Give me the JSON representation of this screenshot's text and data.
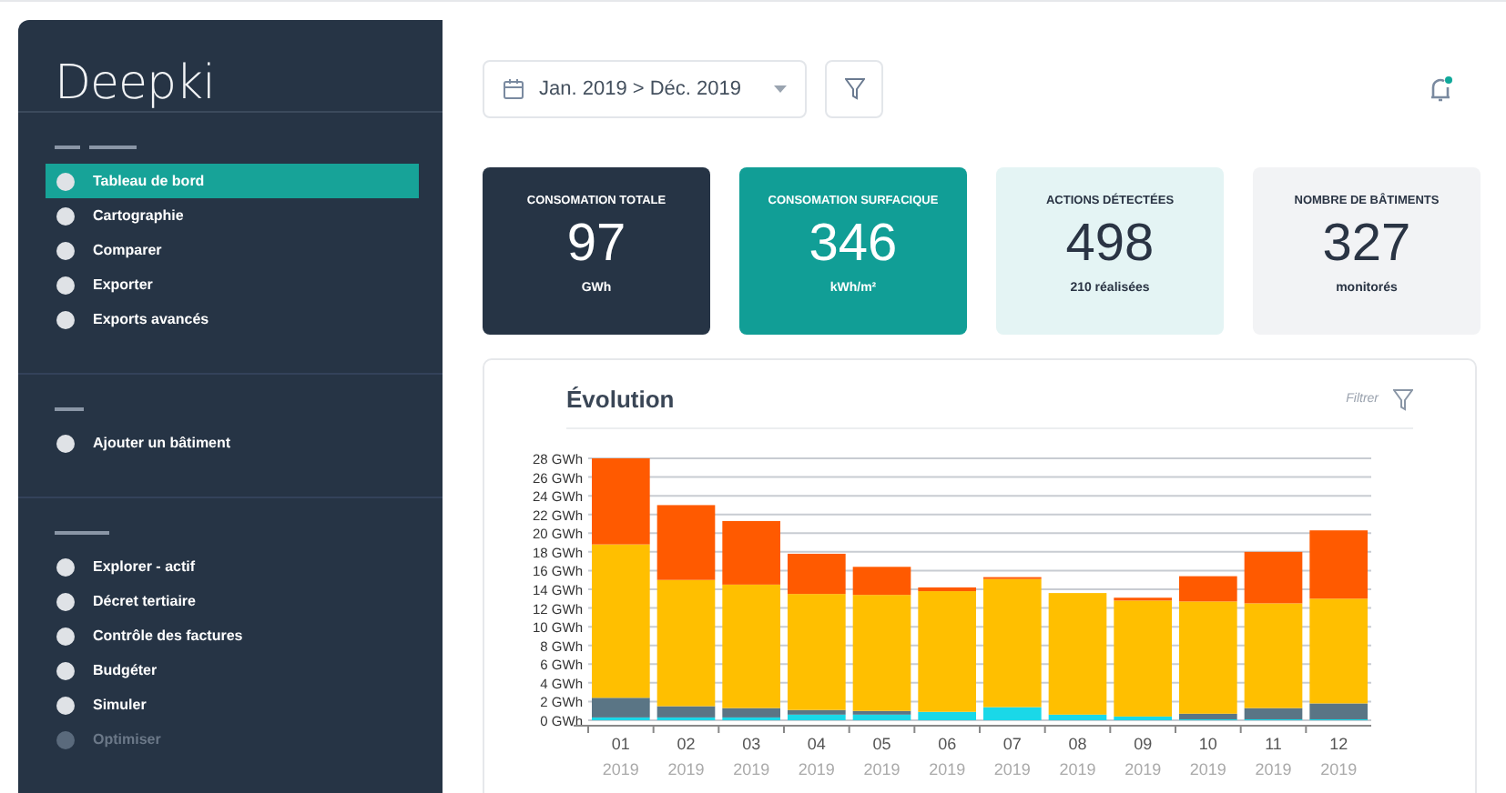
{
  "sidebar": {
    "logo": "Deepki",
    "sections": [
      {
        "items": [
          {
            "label": "Tableau de bord",
            "selected": true,
            "disabled": false
          },
          {
            "label": "Cartographie",
            "selected": false,
            "disabled": false
          },
          {
            "label": "Comparer",
            "selected": false,
            "disabled": false
          },
          {
            "label": "Exporter",
            "selected": false,
            "disabled": false
          },
          {
            "label": "Exports avancés",
            "selected": false,
            "disabled": false
          }
        ]
      },
      {
        "items": [
          {
            "label": "Ajouter un bâtiment",
            "selected": false,
            "disabled": false
          }
        ]
      },
      {
        "items": [
          {
            "label": "Explorer - actif",
            "selected": false,
            "disabled": false
          },
          {
            "label": "Décret tertiaire",
            "selected": false,
            "disabled": false
          },
          {
            "label": "Contrôle des factures",
            "selected": false,
            "disabled": false
          },
          {
            "label": "Budgéter",
            "selected": false,
            "disabled": false
          },
          {
            "label": "Simuler",
            "selected": false,
            "disabled": false
          },
          {
            "label": "Optimiser",
            "selected": false,
            "disabled": true
          }
        ]
      }
    ]
  },
  "toolbar": {
    "date_range": "Jan. 2019 > Déc. 2019",
    "notification_dot": true
  },
  "kpis": [
    {
      "kind": "dark",
      "title": "CONSOMATION TOTALE",
      "value": "97",
      "caption": "GWh"
    },
    {
      "kind": "teal",
      "title": "CONSOMATION SURFACIQUE",
      "value": "346",
      "caption": "kWh/m²"
    },
    {
      "kind": "pale",
      "title": "ACTIONS DÉTECTÉES",
      "value": "498",
      "caption": "210 réalisées"
    },
    {
      "kind": "grey",
      "title": "NOMBRE DE BÂTIMENTS",
      "value": "327",
      "caption": "monitorés"
    }
  ],
  "evolution": {
    "title": "Évolution",
    "filter_label": "Filtrer",
    "chart_data": {
      "type": "bar",
      "stacked": true,
      "grid": true,
      "categories": [
        {
          "month": "01",
          "year": "2019"
        },
        {
          "month": "02",
          "year": "2019"
        },
        {
          "month": "03",
          "year": "2019"
        },
        {
          "month": "04",
          "year": "2019"
        },
        {
          "month": "05",
          "year": "2019"
        },
        {
          "month": "06",
          "year": "2019"
        },
        {
          "month": "07",
          "year": "2019"
        },
        {
          "month": "08",
          "year": "2019"
        },
        {
          "month": "09",
          "year": "2019"
        },
        {
          "month": "10",
          "year": "2019"
        },
        {
          "month": "11",
          "year": "2019"
        },
        {
          "month": "12",
          "year": "2019"
        }
      ],
      "ylim": [
        0,
        28
      ],
      "yticks": [
        {
          "value": 0,
          "label": "0 GWh"
        },
        {
          "value": 2,
          "label": "2 GWh"
        },
        {
          "value": 4,
          "label": "4 GWh"
        },
        {
          "value": 6,
          "label": "6 GWh"
        },
        {
          "value": 8,
          "label": "8 GWh"
        },
        {
          "value": 10,
          "label": "10 GWh"
        },
        {
          "value": 12,
          "label": "12 GWh"
        },
        {
          "value": 14,
          "label": "14 GWh"
        },
        {
          "value": 16,
          "label": "16 GWh"
        },
        {
          "value": 18,
          "label": "18 GWh"
        },
        {
          "value": 20,
          "label": "20 GWh"
        },
        {
          "value": 22,
          "label": "22 GWh"
        },
        {
          "value": 24,
          "label": "24 GWh"
        },
        {
          "value": 26,
          "label": "26 GWh"
        },
        {
          "value": 28,
          "label": "28 GWh"
        }
      ],
      "series": [
        {
          "color": "#1ad8e8",
          "values": [
            0.3,
            0.3,
            0.3,
            0.6,
            0.6,
            0.9,
            1.4,
            0.6,
            0.4,
            0.1,
            0.1,
            0.1
          ]
        },
        {
          "color": "#5a7585",
          "values": [
            2.1,
            1.2,
            1.0,
            0.5,
            0.4,
            0,
            0,
            0,
            0,
            0.6,
            1.2,
            1.7
          ]
        },
        {
          "color": "#ffbf00",
          "values": [
            16.4,
            13.5,
            13.2,
            12.4,
            12.4,
            12.9,
            13.7,
            13.0,
            12.4,
            12.0,
            11.2,
            11.2
          ]
        },
        {
          "color": "#ff5a00",
          "values": [
            9.2,
            8.0,
            6.8,
            4.3,
            3.0,
            0.4,
            0.2,
            0,
            0.3,
            2.7,
            5.5,
            7.3
          ]
        }
      ]
    }
  }
}
